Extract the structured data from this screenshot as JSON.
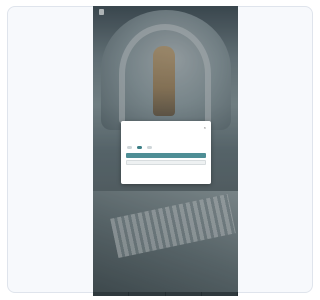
{
  "nav": {
    "items": [
      "",
      "",
      "",
      "",
      ""
    ]
  },
  "hero": {
    "line1": "",
    "line2": ""
  },
  "cookie_dialog": {
    "title": "",
    "body": "",
    "toggles": [
      {
        "label": "",
        "on": false
      },
      {
        "label": "",
        "on": true
      },
      {
        "label": "",
        "on": false
      }
    ],
    "accept_label": "",
    "save_label": "",
    "link1": "",
    "link2": ""
  },
  "colors": {
    "accent": "#4e8e95"
  }
}
